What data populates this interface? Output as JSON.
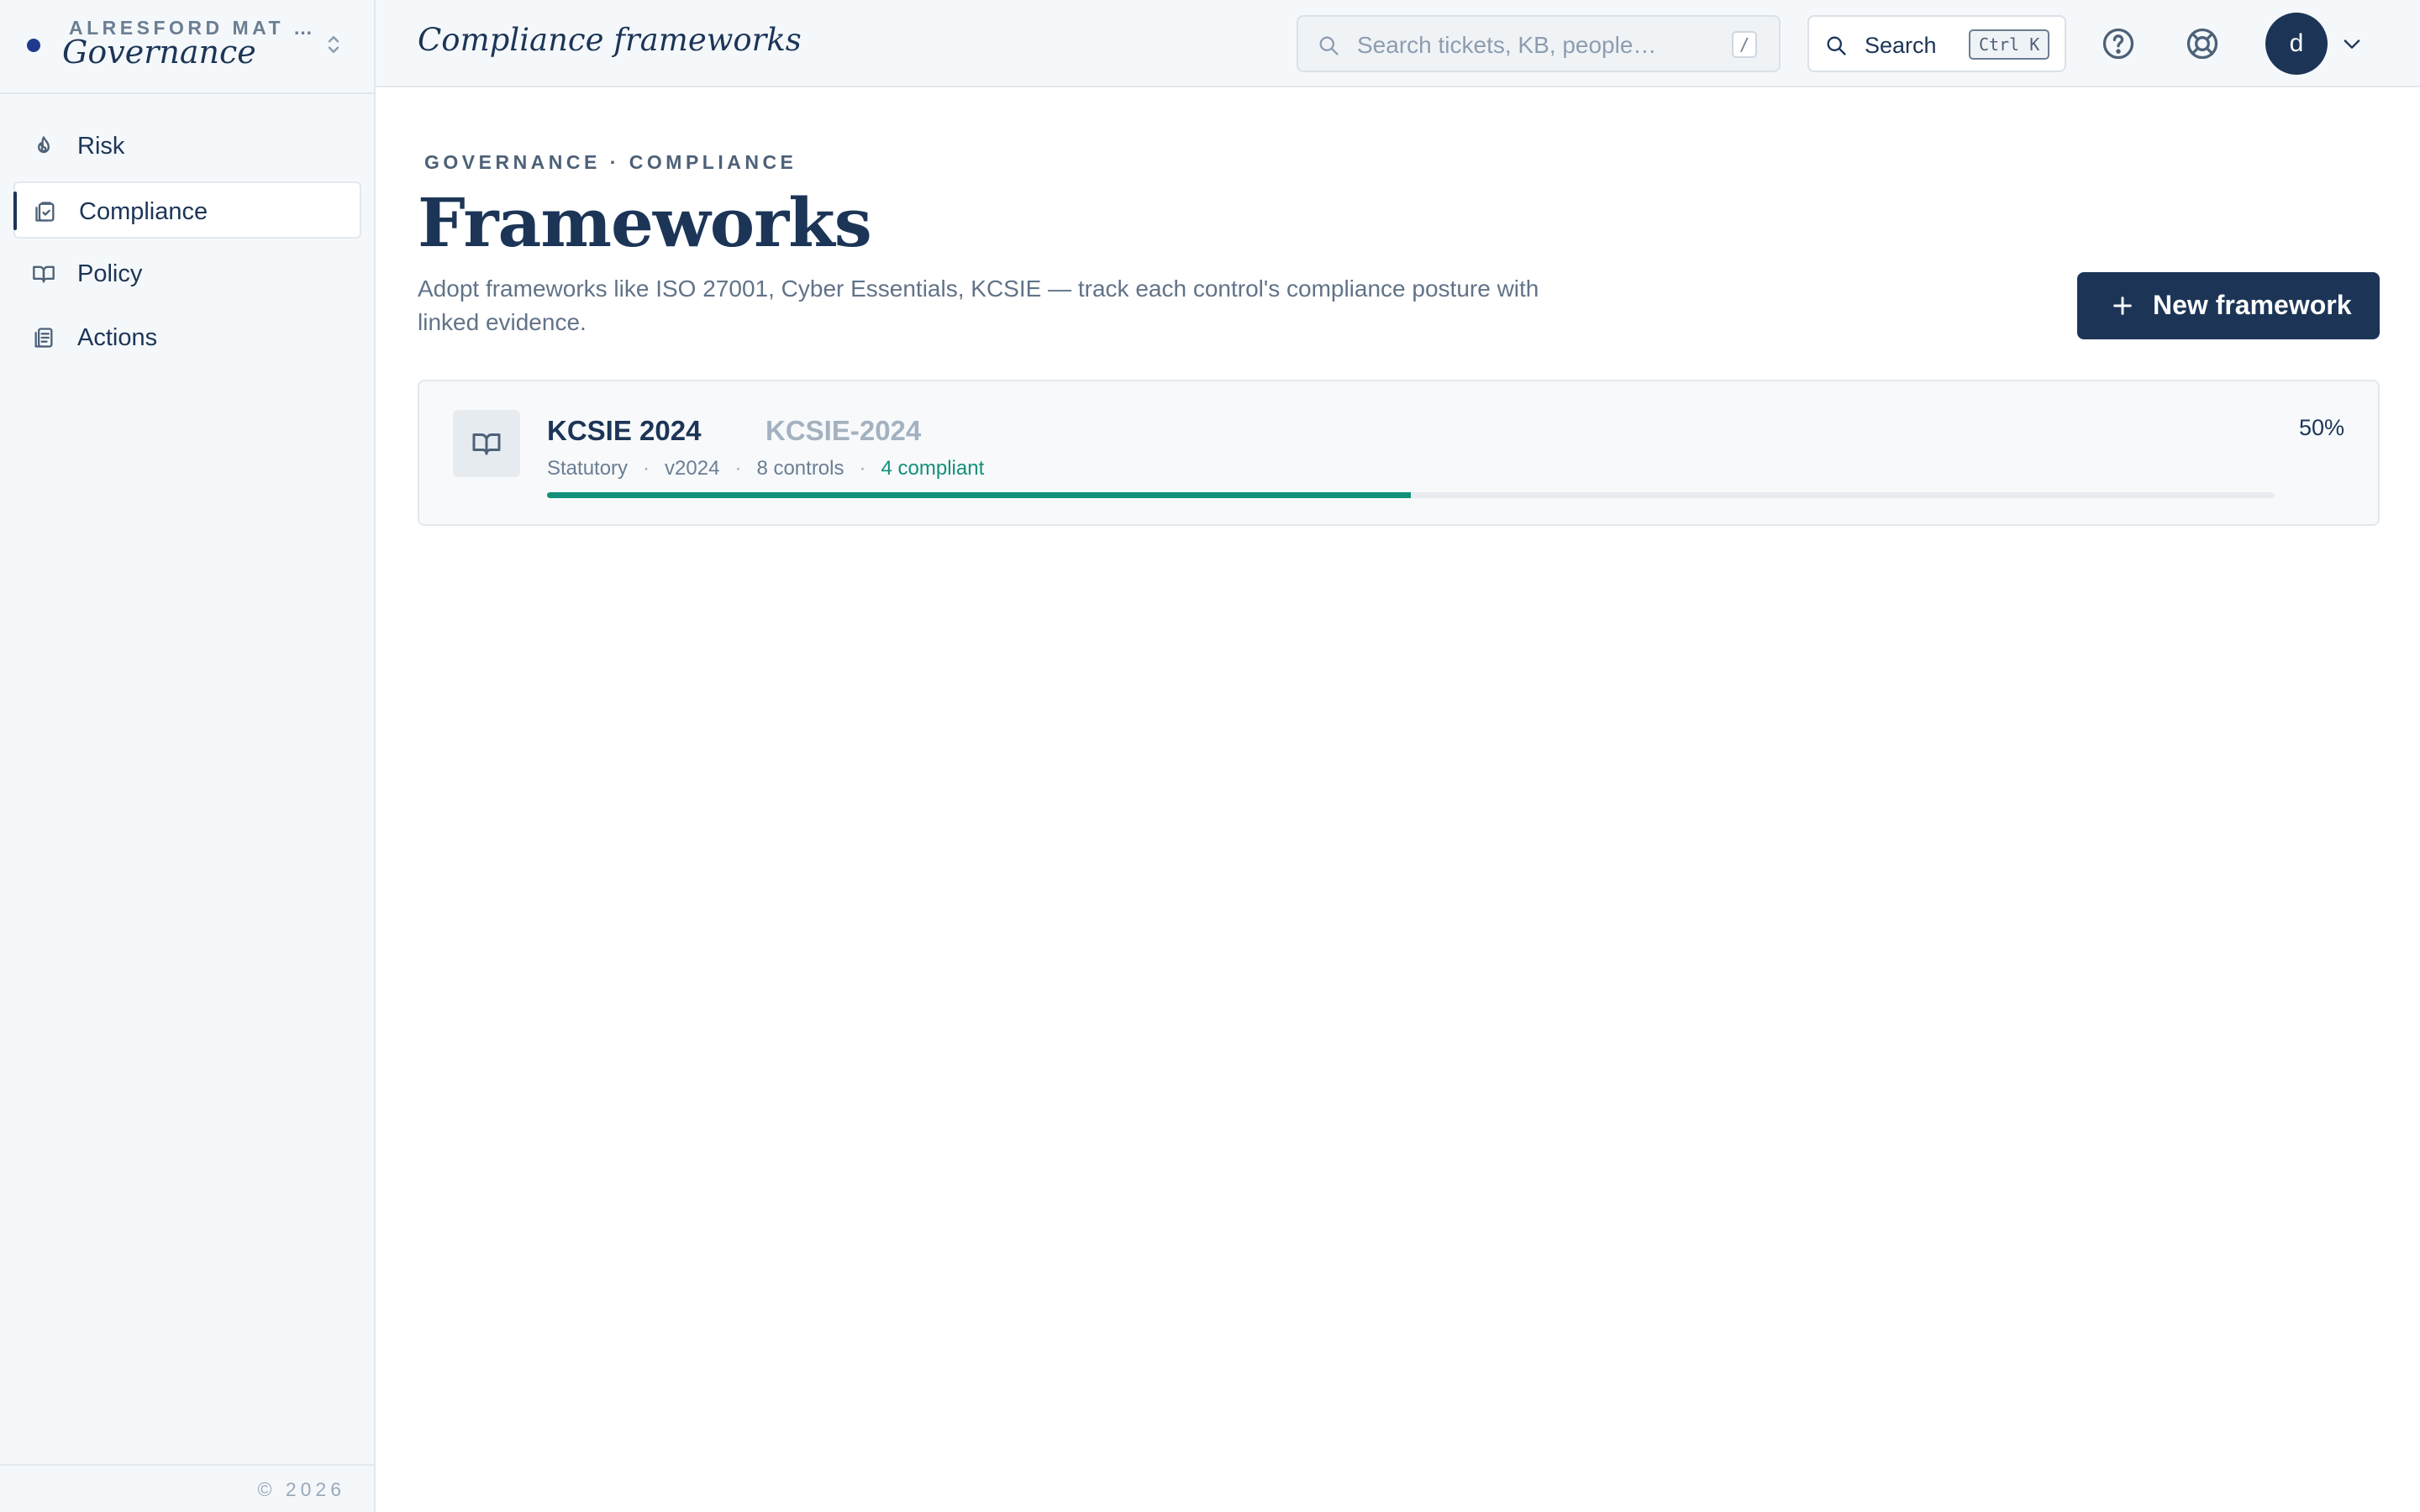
{
  "brand": {
    "org": "ALRESFORD MAT …",
    "title": "Governance"
  },
  "sidebar": {
    "items": [
      {
        "label": "Risk",
        "icon": "flame-icon",
        "active": false
      },
      {
        "label": "Compliance",
        "icon": "clipboard-check-icon",
        "active": true
      },
      {
        "label": "Policy",
        "icon": "book-open-icon",
        "active": false
      },
      {
        "label": "Actions",
        "icon": "checklist-icon",
        "active": false
      }
    ],
    "copyright": "© 2026"
  },
  "topbar": {
    "page_label": "Compliance frameworks",
    "search_placeholder": "Search tickets, KB, people…",
    "search_shortcut": "/",
    "search_button_label": "Search",
    "search_button_kbd": "Ctrl K",
    "avatar_initial": "d"
  },
  "main": {
    "breadcrumb": "GOVERNANCE · COMPLIANCE",
    "title": "Frameworks",
    "subtitle": "Adopt frameworks like ISO 27001, Cyber Essentials, KCSIE — track each control's compliance posture with linked evidence.",
    "new_button_label": "New framework",
    "frameworks": [
      {
        "name": "KCSIE 2024",
        "code": "KCSIE-2024",
        "type": "Statutory",
        "version": "v2024",
        "controls": "8 controls",
        "compliant": "4 compliant",
        "percent_label": "50%",
        "progress": 0.5
      }
    ]
  },
  "colors": {
    "primary": "#1c3557",
    "accent_green": "#12907a",
    "sidebar_bg": "#f5f8fa",
    "border": "#e3e8ee"
  }
}
